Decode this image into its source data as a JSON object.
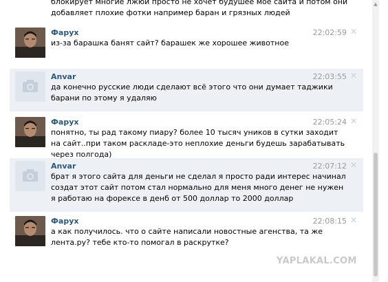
{
  "top_partial_text": "блокирует многие лжюи просто не хочет будушее моё сайта и потом они добавляет плохие фотки например баран и грязных людей",
  "messages": [
    {
      "author": "Фарух",
      "time": "22:02:59",
      "avatar": "person-photo",
      "text": "из-за барашка банят сайт? барашек же хорошее животное"
    },
    {
      "author": "Anvar",
      "time": "22:03:55",
      "avatar": "camera-placeholder",
      "text": "да конечно русские люди сделают всё этого что они думает таджики барани по этому я удаляю"
    },
    {
      "author": "Фарух",
      "time": "22:05:24",
      "avatar": "person-photo",
      "text": "понятно, ты рад такому пиару? более 10 тысяч уников в сутки заходит на сайт..при таком раскладе-это неплохие деньги будешь зарабатывать через полгода)"
    },
    {
      "author": "Anvar",
      "time": "22:07:12",
      "avatar": "camera-placeholder",
      "text": "брат я этого сайта для деньги не сделал я просто ради интерес начинал создат этот сайт потом стал нормально для меня много денег не нужен я работаю на форексе в денб от 500 доллар то 2000 доллар"
    },
    {
      "author": "Фарух",
      "time": "22:08:15",
      "avatar": "person-photo",
      "text": "а как получилось. что о сайте написали новостные агенства, та же лента.ру? тебе кто-то помогал в раскрутке?"
    }
  ],
  "delete_glyph": "✕",
  "watermark": "YAPLAKAL.COM",
  "colors": {
    "author": "#2b587a",
    "highlight_bg": "#edf1f5",
    "time": "#999999"
  }
}
